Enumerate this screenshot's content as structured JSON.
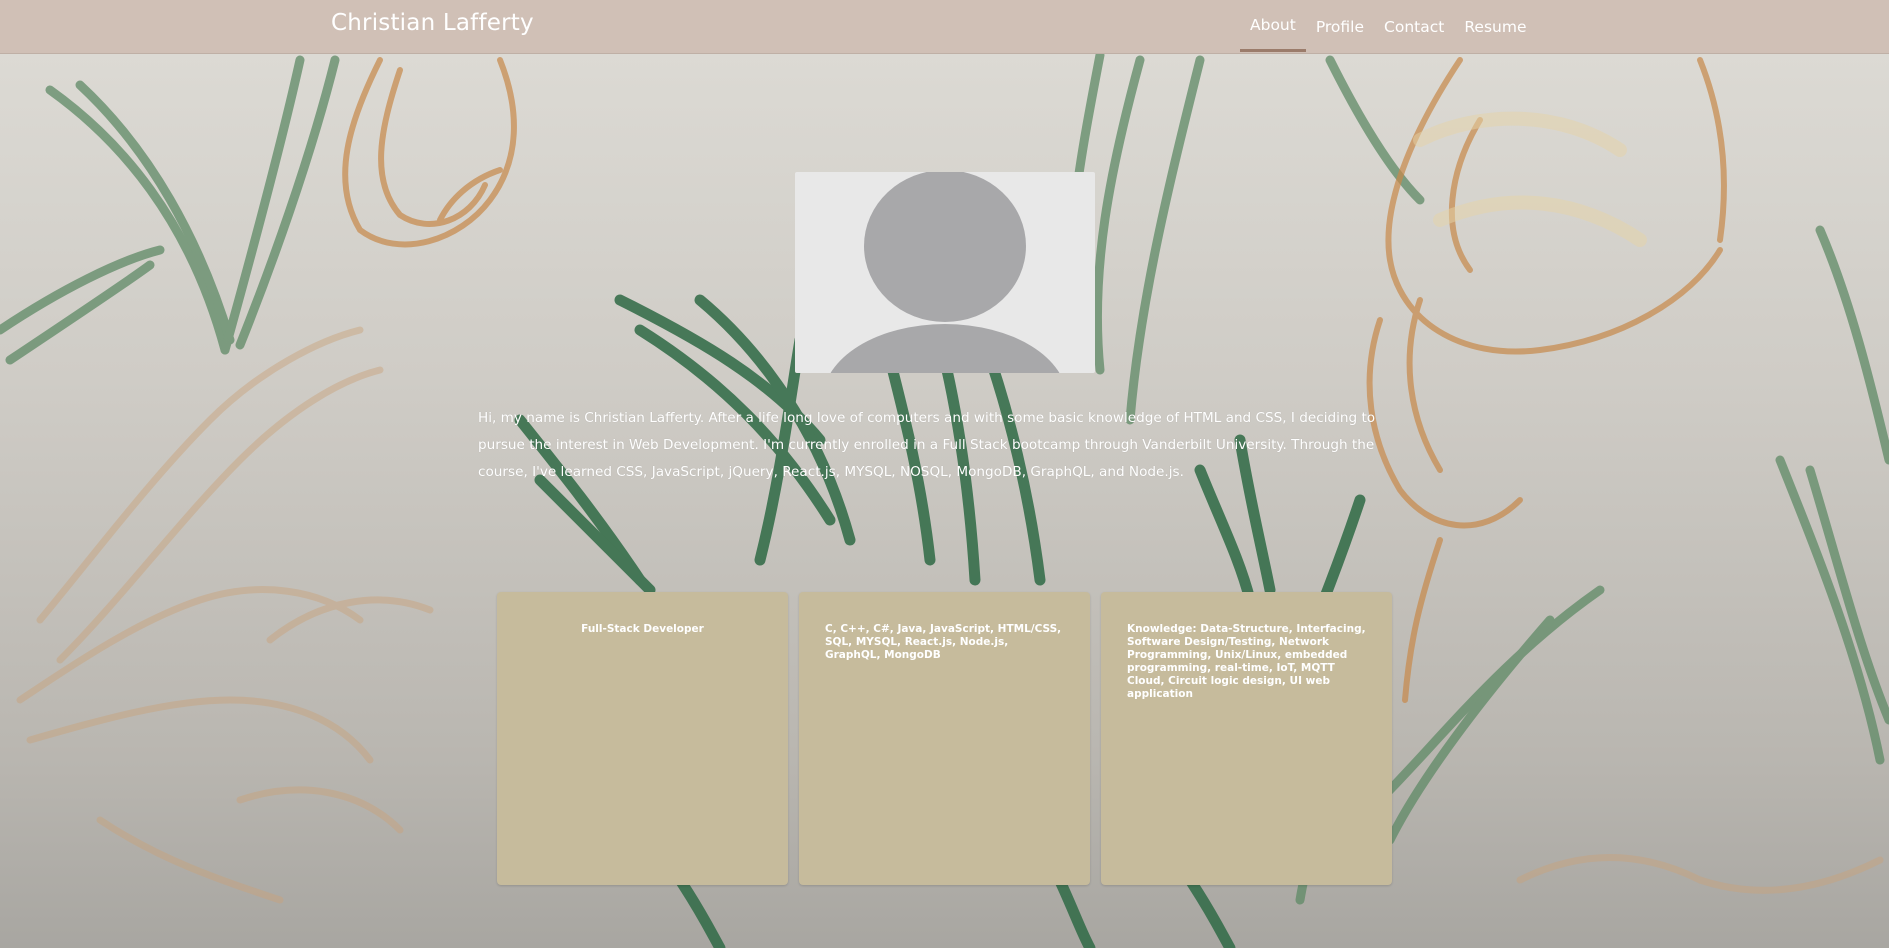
{
  "header": {
    "brand": "Christian Lafferty",
    "nav": [
      {
        "label": "About",
        "active": true
      },
      {
        "label": "Profile",
        "active": false
      },
      {
        "label": "Contact",
        "active": false
      },
      {
        "label": "Resume",
        "active": false
      }
    ]
  },
  "about": {
    "avatar_icon": "default-user-avatar-icon",
    "bio": "Hi, my name is Christian Lafferty. After a life long love of computers and with some basic knowledge of HTML and CSS, I deciding to pursue the interest in Web Development. I'm currently enrolled in a Full Stack bootcamp through Vanderbilt University. Through the course, I've learned CSS, JavaScript, jQuery, React.js, MYSQL, NOSQL, MongoDB, GraphQL, and Node.js."
  },
  "cards": [
    {
      "text": "Full-Stack Developer"
    },
    {
      "text": "C, C++, C#, Java, JavaScript, HTML/CSS, SQL, MYSQL, React.js, Node.js, GraphQL, MongoDB"
    },
    {
      "text": "Knowledge: Data-Structure, Interfacing, Software Design/Testing, Network Programming, Unix/Linux, embedded programming, real-time, IoT, MQTT Cloud, Circuit logic design, UI web application"
    }
  ],
  "colors": {
    "navbar": "#d0c0b6",
    "active_underline": "#9b7c6b",
    "card": "#c6bb9c",
    "text": "#ffffff"
  }
}
